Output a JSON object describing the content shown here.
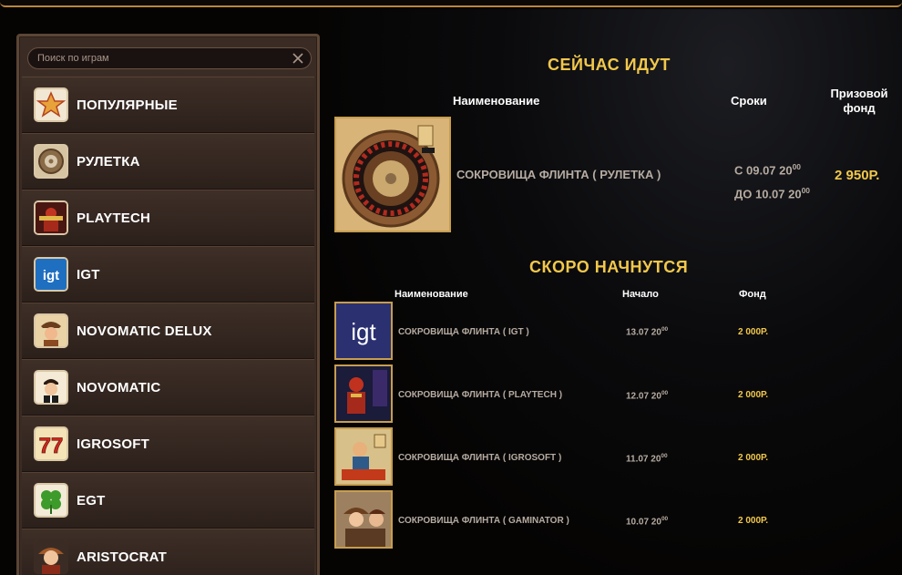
{
  "search": {
    "placeholder": "Поиск по играм"
  },
  "sidebar": {
    "items": [
      {
        "label": "ПОПУЛЯРНЫЕ",
        "icon": "star-icon"
      },
      {
        "label": "РУЛЕТКА",
        "icon": "roulette-icon"
      },
      {
        "label": "PLAYTECH",
        "icon": "playtech-icon"
      },
      {
        "label": "IGT",
        "icon": "igt-logo-icon"
      },
      {
        "label": "NOVOMATIC DELUX",
        "icon": "novomatic-delux-icon"
      },
      {
        "label": "NOVOMATIC",
        "icon": "novomatic-icon"
      },
      {
        "label": "IGROSOFT",
        "icon": "seven-seven-icon"
      },
      {
        "label": "EGT",
        "icon": "clover-icon"
      },
      {
        "label": "ARISTOCRAT",
        "icon": "aristocrat-icon"
      }
    ]
  },
  "current": {
    "title": "СЕЙЧАС ИДУТ",
    "col_name": "Наименование",
    "col_dates": "Сроки",
    "col_prize_line1": "Призовой",
    "col_prize_line2": "фонд",
    "item": {
      "name": "СОКРОВИЩА ФЛИНТА ( РУЛЕТКА )",
      "date_from": "С 09.07 20",
      "date_from_sup": "00",
      "date_to": "ДО 10.07 20",
      "date_to_sup": "00",
      "prize": "2 950Р."
    }
  },
  "upcoming": {
    "title": "СКОРО НАЧНУТСЯ",
    "col_name": "Наименование",
    "col_start": "Начало",
    "col_fund": "Фонд",
    "items": [
      {
        "name": "СОКРОВИЩА ФЛИНТА ( IGT )",
        "start": "13.07 20",
        "start_sup": "00",
        "fund": "2 000Р.",
        "thumb": "igt-logo-icon"
      },
      {
        "name": "СОКРОВИЩА ФЛИНТА ( PLAYTECH )",
        "start": "12.07 20",
        "start_sup": "00",
        "fund": "2 000Р.",
        "thumb": "playtech-icon"
      },
      {
        "name": "СОКРОВИЩА ФЛИНТА ( IGROSOFT )",
        "start": "11.07 20",
        "start_sup": "00",
        "fund": "2 000Р.",
        "thumb": "igrosoft-icon"
      },
      {
        "name": "СОКРОВИЩА ФЛИНТА ( GAMINATOR )",
        "start": "10.07 20",
        "start_sup": "00",
        "fund": "2 000Р.",
        "thumb": "gaminator-icon"
      }
    ]
  },
  "colors": {
    "gold": "#f2c84b",
    "muted": "#b6aba1",
    "panel": "#3a2c24"
  }
}
